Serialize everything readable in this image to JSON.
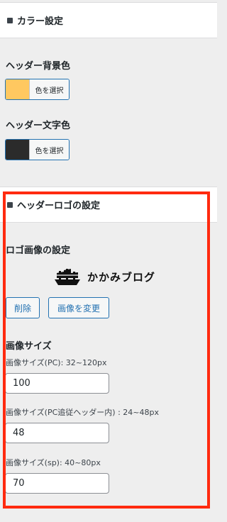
{
  "color_settings": {
    "section_title": "カラー設定",
    "header_bg_label": "ヘッダー背景色",
    "header_bg_button": "色を選択",
    "header_bg_color": "#ffc860",
    "header_text_label": "ヘッダー文字色",
    "header_text_button": "色を選択",
    "header_text_color": "#2b2b2b"
  },
  "logo_settings": {
    "section_title": "ヘッダーロゴの設定",
    "logo_image_label": "ロゴ画像の設定",
    "logo_text": "かかみブログ",
    "delete_button": "削除",
    "change_button": "画像を変更",
    "image_size_heading": "画像サイズ",
    "pc_label": "画像サイズ(PC): 32~120px",
    "pc_value": "100",
    "pc_follow_label": "画像サイズ(PC追従ヘッダー内) : 24~48px",
    "pc_follow_value": "48",
    "sp_label": "画像サイズ(sp): 40~80px",
    "sp_value": "70"
  },
  "highlight_color": "#ff2a0f"
}
